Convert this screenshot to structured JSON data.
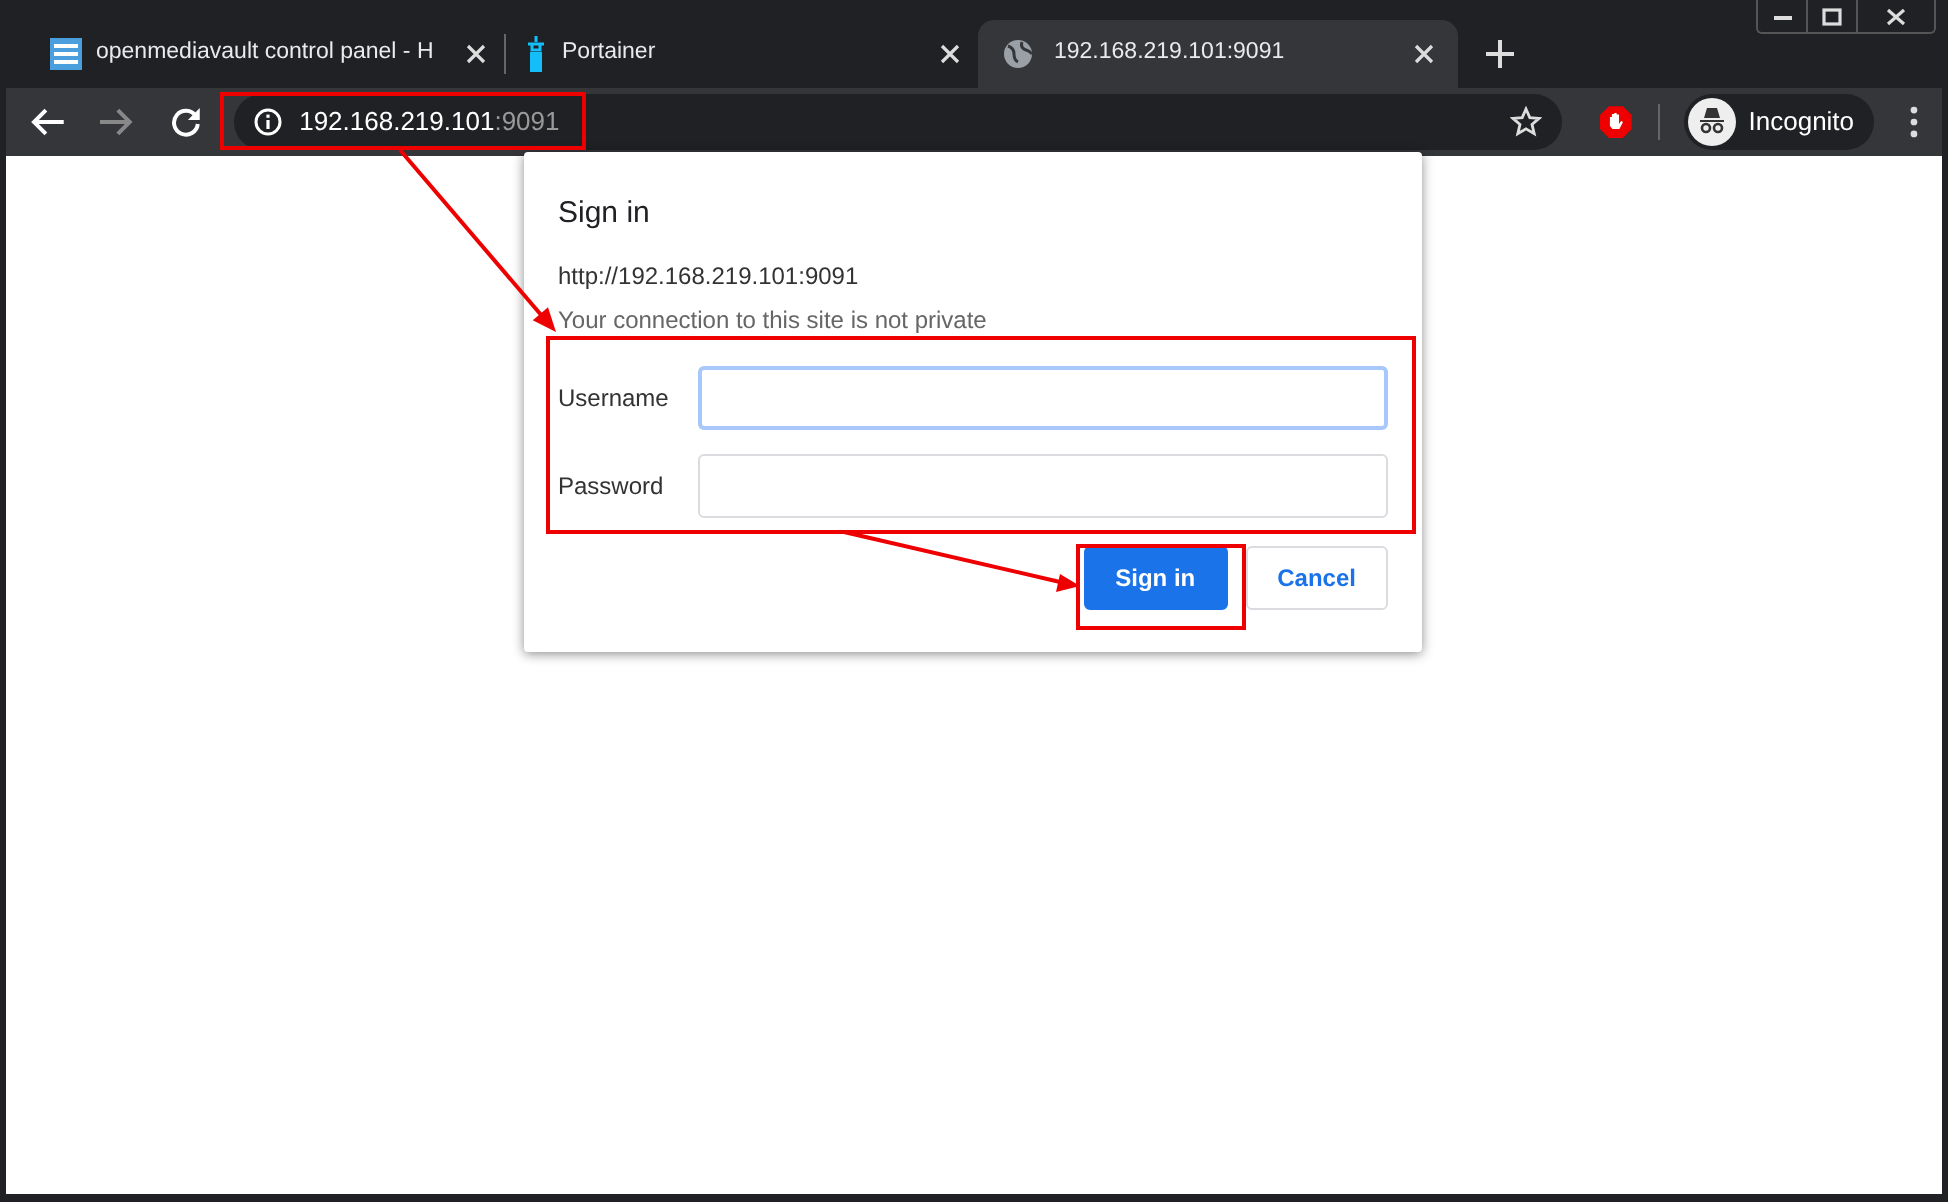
{
  "tabs": [
    {
      "title": "openmediavault control panel - H",
      "kind": "list",
      "selected": false
    },
    {
      "title": "Portainer",
      "kind": "bottle",
      "selected": false
    },
    {
      "title": "192.168.219.101:9091",
      "kind": "globe",
      "selected": true
    }
  ],
  "address_bar": {
    "host": "192.168.219.101",
    "port": ":9091"
  },
  "profile": {
    "label": "Incognito"
  },
  "dialog": {
    "title": "Sign in",
    "origin": "http://192.168.219.101:9091",
    "note": "Your connection to this site is not private",
    "fields": [
      {
        "label": "Username",
        "focused": true
      },
      {
        "label": "Password",
        "focused": false
      }
    ],
    "buttons": [
      {
        "label": "Sign in",
        "kind": "primary"
      },
      {
        "label": "Cancel",
        "kind": "secondary"
      }
    ]
  }
}
